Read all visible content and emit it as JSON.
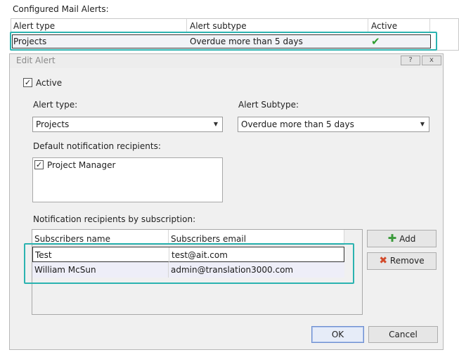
{
  "configured": {
    "label": "Configured Mail Alerts:",
    "columns": [
      "Alert type",
      "Alert subtype",
      "Active"
    ],
    "row": {
      "type": "Projects",
      "subtype": "Overdue more than 5 days",
      "active_icon": "check-icon"
    }
  },
  "dialog": {
    "title": "Edit Alert",
    "help_btn": "?",
    "close_btn": "x",
    "active_label": "Active",
    "alert_type_label": "Alert type:",
    "alert_type_value": "Projects",
    "alert_subtype_label": "Alert Subtype:",
    "alert_subtype_value": "Overdue more than 5 days",
    "default_recipients_label": "Default notification recipients:",
    "default_recipients": [
      {
        "label": "Project Manager",
        "checked": true
      }
    ],
    "subs_label": "Notification recipients by subscription:",
    "subs_columns": [
      "Subscribers name",
      "Subscribers email"
    ],
    "subs_rows": [
      {
        "name": "Test",
        "email": "test@ait.com"
      },
      {
        "name": "William McSun",
        "email": "admin@translation3000.com"
      }
    ],
    "add_label": "Add",
    "remove_label": "Remove",
    "ok_label": "OK",
    "cancel_label": "Cancel"
  },
  "colors": {
    "highlight": "#2bb3b0",
    "check_green": "#2e9d2e",
    "remove_red": "#d24a2a"
  }
}
